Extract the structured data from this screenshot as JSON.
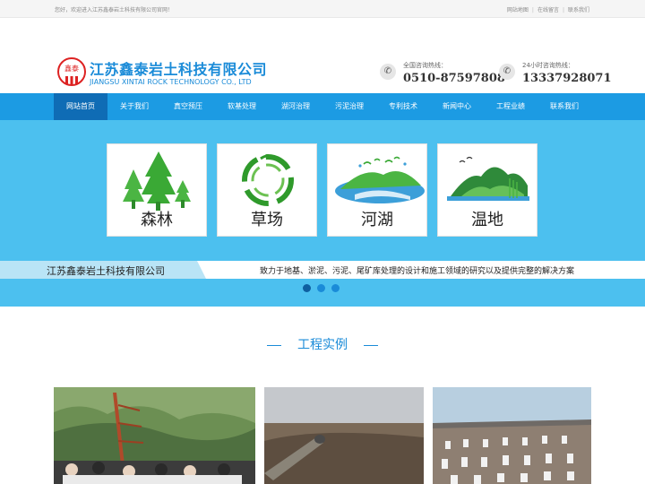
{
  "topbar": {
    "welcome": "您好，欢迎进入江苏鑫泰岩土科技有限公司官网！",
    "links": [
      "网站地图",
      "在线留言",
      "联系我们"
    ]
  },
  "logo": {
    "mark_text": "鑫泰",
    "name_cn": "江苏鑫泰岩土科技有限公司",
    "name_en": "JIANGSU XINTAI ROCK TECHNOLOGY CO., LTD"
  },
  "hotlines": [
    {
      "label": "全国咨询热线：",
      "number": "0510-87597808"
    },
    {
      "label": "24小时咨询热线：",
      "number": "13337928071"
    }
  ],
  "nav": {
    "items": [
      "网站首页",
      "关于我们",
      "真空预压",
      "软基处理",
      "湖河治理",
      "污泥治理",
      "专利技术",
      "新闻中心",
      "工程业绩",
      "联系我们"
    ],
    "active_index": 0
  },
  "banner": {
    "cards": [
      {
        "label": "森林",
        "icon": "forest-icon"
      },
      {
        "label": "草场",
        "icon": "grassland-icon"
      },
      {
        "label": "河湖",
        "icon": "river-lake-icon"
      },
      {
        "label": "温地",
        "icon": "wetland-icon"
      }
    ],
    "company": "江苏鑫泰岩土科技有限公司",
    "slogan": "致力于地基、淤泥、污泥、尾矿库处理的设计和施工领域的研究以及提供完整的解决方案",
    "slide_count": 3,
    "active_slide": 0
  },
  "section": {
    "title": "工程实例"
  },
  "colors": {
    "brand_blue": "#1a8bd8",
    "nav_bg": "#1c9be3",
    "nav_active": "#0f6cb5",
    "banner_bg": "#4cc0ef",
    "logo_red": "#dd2222"
  }
}
